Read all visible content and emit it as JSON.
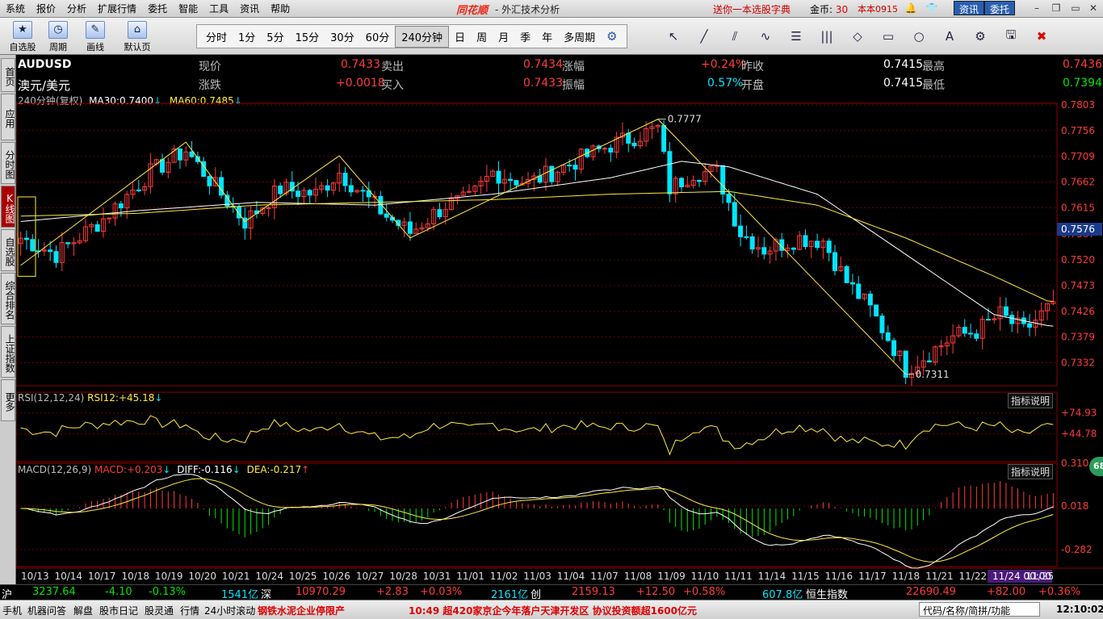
{
  "menubar": {
    "items": [
      "系统",
      "报价",
      "分析",
      "扩展行情",
      "委托",
      "智能",
      "工具",
      "资讯",
      "帮助"
    ],
    "logo": "同花顺",
    "title": "- 外汇技术分析",
    "promo": "送你一本选股字典",
    "coins_label": "金币:",
    "coins_value": "30",
    "version": "本本0915",
    "news_button": "资讯",
    "trade_button": "委托"
  },
  "toolbar": {
    "big_buttons": [
      {
        "label": "自选股",
        "icon": "star-icon"
      },
      {
        "label": "周期",
        "icon": "clock-icon"
      },
      {
        "label": "画线",
        "icon": "pencil-icon"
      },
      {
        "label": "默认页",
        "icon": "home-icon"
      }
    ],
    "periods": [
      "分时",
      "1分",
      "5分",
      "15分",
      "30分",
      "60分",
      "240分钟",
      "日",
      "周",
      "月",
      "季",
      "年",
      "多周期"
    ],
    "selected_period": "240分钟"
  },
  "sidetabs": [
    "首页",
    "应用",
    "分时图",
    "K线图",
    "自选股",
    "综合排名",
    "上证指数",
    "更多"
  ],
  "selected_sidetab": "K线图",
  "quote": {
    "symbol": "AUDUSD",
    "name": "澳元/美元",
    "row1": [
      {
        "label": "现价",
        "value": "0.7433"
      },
      {
        "label": "卖出",
        "value": "0.7434"
      },
      {
        "label": "涨幅",
        "value": "+0.24%"
      },
      {
        "label": "昨收",
        "value": "0.7415"
      },
      {
        "label": "最高",
        "value": "0.7436"
      }
    ],
    "row2": [
      {
        "label": "涨跌",
        "value": "+0.0018"
      },
      {
        "label": "买入",
        "value": "0.7433"
      },
      {
        "label": "振幅",
        "value": "0.57%"
      },
      {
        "label": "开盘",
        "value": "0.7415"
      },
      {
        "label": "最低",
        "value": "0.7394"
      }
    ]
  },
  "indicators": {
    "main_label": "240分钟(复权)",
    "ma30_label": "MA30:",
    "ma30_value": "0.7400",
    "ma60_label": "MA60:",
    "ma60_value": "0.7485",
    "rsi_label": "RSI(12,12,24)",
    "rsi12_label": "RSI12:",
    "rsi12_value": "+45.18",
    "macd_label": "MACD(12,26,9)",
    "macd_value_label": "MACD:",
    "macd_value": "+0.203",
    "diff_label": "DIFF:",
    "diff_value": "-0.116",
    "dea_label": "DEA:",
    "dea_value": "-0.217",
    "help_label": "指标说明",
    "badge": "68"
  },
  "chart_data": {
    "type": "candlestick",
    "title": "AUDUSD",
    "xlabel": "",
    "ylabel": "",
    "x_ticks": [
      "10/13",
      "10/14",
      "10/17",
      "10/18",
      "10/19",
      "10/20",
      "10/21",
      "10/24",
      "10/25",
      "10/26",
      "10/27",
      "10/28",
      "10/31",
      "11/01",
      "11/02",
      "11/03",
      "11/04",
      "11/07",
      "11/08",
      "11/09",
      "11/10",
      "11/11",
      "11/14",
      "11/15",
      "11/16",
      "11/17",
      "11/18",
      "11/21",
      "11/22",
      "11/24 00:00",
      "11/25"
    ],
    "price_ticks": [
      "0.7803",
      "0.7756",
      "0.7709",
      "0.7662",
      "0.7615",
      "0.7567",
      "0.7520",
      "0.7473",
      "0.7426",
      "0.7379",
      "0.7332"
    ],
    "ylim": [
      0.7293,
      0.7803
    ],
    "current_price_label": "0.7576",
    "annotations": [
      {
        "label": "0.7777",
        "x_index": 108,
        "y": 0.7777
      },
      {
        "label": "0.7311",
        "x_index": 150,
        "y": 0.7311
      }
    ],
    "anchor_points": [
      [
        0,
        0.756
      ],
      [
        6,
        0.753
      ],
      [
        14,
        0.7595
      ],
      [
        22,
        0.768
      ],
      [
        28,
        0.772
      ],
      [
        34,
        0.764
      ],
      [
        38,
        0.759
      ],
      [
        44,
        0.765
      ],
      [
        50,
        0.764
      ],
      [
        54,
        0.768
      ],
      [
        58,
        0.764
      ],
      [
        62,
        0.76
      ],
      [
        66,
        0.757
      ],
      [
        72,
        0.762
      ],
      [
        76,
        0.763
      ],
      [
        80,
        0.768
      ],
      [
        86,
        0.766
      ],
      [
        92,
        0.769
      ],
      [
        100,
        0.773
      ],
      [
        108,
        0.776
      ],
      [
        110,
        0.765
      ],
      [
        114,
        0.768
      ],
      [
        118,
        0.768
      ],
      [
        122,
        0.757
      ],
      [
        126,
        0.754
      ],
      [
        132,
        0.756
      ],
      [
        136,
        0.7555
      ],
      [
        140,
        0.748
      ],
      [
        144,
        0.743
      ],
      [
        148,
        0.736
      ],
      [
        150,
        0.732
      ],
      [
        154,
        0.735
      ],
      [
        158,
        0.738
      ],
      [
        162,
        0.739
      ],
      [
        166,
        0.742
      ],
      [
        170,
        0.739
      ],
      [
        174,
        0.743
      ]
    ],
    "ma30_anchors": [
      [
        0,
        0.759
      ],
      [
        20,
        0.761
      ],
      [
        40,
        0.7625
      ],
      [
        60,
        0.762
      ],
      [
        80,
        0.764
      ],
      [
        100,
        0.767
      ],
      [
        112,
        0.77
      ],
      [
        120,
        0.769
      ],
      [
        135,
        0.764
      ],
      [
        150,
        0.753
      ],
      [
        165,
        0.742
      ],
      [
        174,
        0.74
      ]
    ],
    "ma60_anchors": [
      [
        0,
        0.76
      ],
      [
        20,
        0.7605
      ],
      [
        40,
        0.762
      ],
      [
        60,
        0.7625
      ],
      [
        80,
        0.763
      ],
      [
        100,
        0.764
      ],
      [
        120,
        0.7645
      ],
      [
        135,
        0.762
      ],
      [
        150,
        0.756
      ],
      [
        165,
        0.749
      ],
      [
        174,
        0.7445
      ]
    ],
    "rsi_ticks": [
      "+74.93",
      "+44.78"
    ],
    "macd_ticks": [
      "0.310",
      "0.018",
      "-0.282"
    ]
  },
  "bottom": {
    "sh_label": "沪",
    "sh_index": "3237.64",
    "sh_chg": "-4.10",
    "sh_pct": "-0.13%",
    "sh_vol": "1541亿",
    "sz_label": "深",
    "sz_index": "10970.29",
    "sz_chg": "+2.83",
    "sz_pct": "+0.03%",
    "sz_vol": "2161亿",
    "cy_label": "创",
    "cy_index": "2159.13",
    "cy_chg": "+12.50",
    "cy_pct": "+0.58%",
    "cy_vol": "607.8亿",
    "hs_label": "恒生指数",
    "hs_index": "22690.49",
    "hs_chg": "+82.00",
    "hs_pct": "+0.36%"
  },
  "status": {
    "items": [
      "手机",
      "机器问答",
      "解盘",
      "股市日记",
      "股灵通",
      "行情",
      "24小时滚动"
    ],
    "headline": "钢铁水泥企业停限产",
    "ticker": "10:49 超420家京企今年落户天津开发区 协议投资额超1600亿元",
    "search_box": "代码/名称/简拼/功能",
    "clock": "12:10:02"
  }
}
